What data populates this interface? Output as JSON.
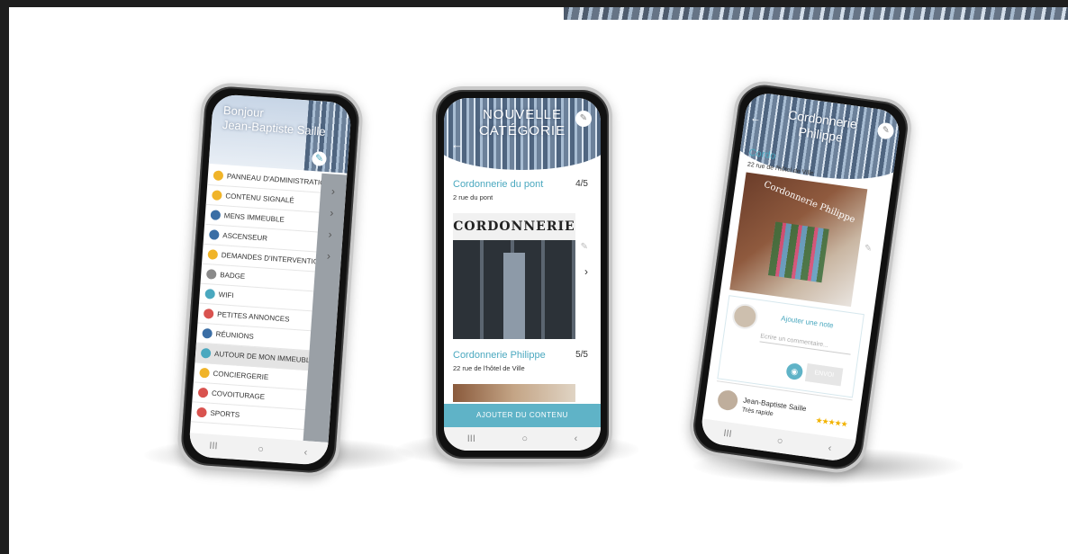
{
  "phone1": {
    "greeting_line1": "Bonjour",
    "greeting_line2": "Jean-Baptiste Saille",
    "menu": [
      {
        "label": "PANNEAU D'ADMINISTRATION",
        "icon": "wrench-icon",
        "color": "#f0b429"
      },
      {
        "label": "CONTENU SIGNALÉ",
        "icon": "flag-icon",
        "color": "#f0b429"
      },
      {
        "label": "MENS IMMEUBLE",
        "icon": "building-icon",
        "color": "#3a6ea5"
      },
      {
        "label": "ASCENSEUR",
        "icon": "elevator-icon",
        "color": "#3a6ea5"
      },
      {
        "label": "DEMANDES D'INTERVENTIONS",
        "icon": "tool-icon",
        "color": "#f0b429"
      },
      {
        "label": "BADGE",
        "icon": "badge-icon",
        "color": "#8a8a8a"
      },
      {
        "label": "WIFI",
        "icon": "wifi-icon",
        "color": "#4aa8bf"
      },
      {
        "label": "PETITES ANNONCES",
        "icon": "tag-icon",
        "color": "#d9534f"
      },
      {
        "label": "RÉUNIONS",
        "icon": "calendar-icon",
        "color": "#3a6ea5"
      },
      {
        "label": "AUTOUR DE MON IMMEUBLE",
        "icon": "location-icon",
        "color": "#4aa8bf",
        "active": true
      },
      {
        "label": "CONCIERGERIE",
        "icon": "bell-icon",
        "color": "#f0b429"
      },
      {
        "label": "COVOITURAGE",
        "icon": "car-icon",
        "color": "#d9534f"
      },
      {
        "label": "SPORTS",
        "icon": "sport-icon",
        "color": "#d9534f"
      }
    ],
    "nav": [
      "III",
      "○",
      "‹"
    ]
  },
  "phone2": {
    "title_line1": "NOUVELLE",
    "title_line2": "CATÉGORIE",
    "items": [
      {
        "name": "Cordonnerie du pont",
        "rating": "4/5",
        "address": "2 rue du pont",
        "sign": "CORDONNERIE"
      },
      {
        "name": "Cordonnerie Philippe",
        "rating": "5/5",
        "address": "22 rue de l'hôtel de Ville"
      }
    ],
    "cta": "AJOUTER DU CONTENU",
    "nav": [
      "III",
      "○",
      "‹"
    ]
  },
  "phone3": {
    "title_line1": "Cordonnerie",
    "title_line2": "Philippe",
    "partial_name": "Cordo",
    "address": "22 rue de l'hôtel de Ville",
    "shop_sign": "Cordonnerie Philippe",
    "review_prompt": "Ajouter une note",
    "review_placeholder": "Ecrire un commentaire...",
    "send_label": "ENVOI",
    "reviewer_name": "Jean-Baptiste Saille",
    "review_text": "Très rapide",
    "stars": "★★★★★",
    "nav": [
      "III",
      "○",
      "‹"
    ]
  }
}
